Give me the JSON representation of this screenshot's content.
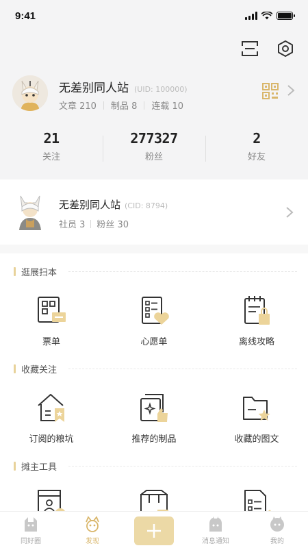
{
  "status": {
    "time": "9:41"
  },
  "profile": {
    "name": "无差别同人站",
    "uid": "(UID: 100000)",
    "stats": [
      "文章 210",
      "制品 8",
      "连载 10"
    ]
  },
  "counters": [
    {
      "value": "21",
      "label": "关注"
    },
    {
      "value": "277327",
      "label": "粉丝"
    },
    {
      "value": "2",
      "label": "好友"
    }
  ],
  "club": {
    "name": "无差别同人站",
    "cid": "(CID: 8794)",
    "stats": [
      "社员 3",
      "粉丝 30"
    ]
  },
  "sections": [
    {
      "title": "逛展扫本",
      "items": [
        {
          "label": "票单",
          "icon": "ticket-icon"
        },
        {
          "label": "心愿单",
          "icon": "wishlist-icon"
        },
        {
          "label": "离线攻略",
          "icon": "offline-guide-icon"
        }
      ]
    },
    {
      "title": "收藏关注",
      "items": [
        {
          "label": "订阅的粮坑",
          "icon": "subscribed-house-icon"
        },
        {
          "label": "推荐的制品",
          "icon": "recommended-product-icon"
        },
        {
          "label": "收藏的图文",
          "icon": "favorite-folder-icon"
        }
      ]
    },
    {
      "title": "摊主工具",
      "items": [
        {
          "label": "",
          "icon": "booth-icon"
        },
        {
          "label": "",
          "icon": "box-icon"
        },
        {
          "label": "",
          "icon": "document-icon"
        }
      ]
    }
  ],
  "tabs": [
    {
      "label": "同好圈",
      "icon": "cat-icon"
    },
    {
      "label": "发现",
      "icon": "discover-icon",
      "active": true
    },
    {
      "label": "",
      "icon": "plus-icon"
    },
    {
      "label": "消息通知",
      "icon": "bell-cat-icon"
    },
    {
      "label": "我的",
      "icon": "profile-cat-icon"
    }
  ],
  "colors": {
    "accent": "#e8d29a",
    "active_tab": "#d9b66a",
    "background": "#f4f4f5"
  }
}
